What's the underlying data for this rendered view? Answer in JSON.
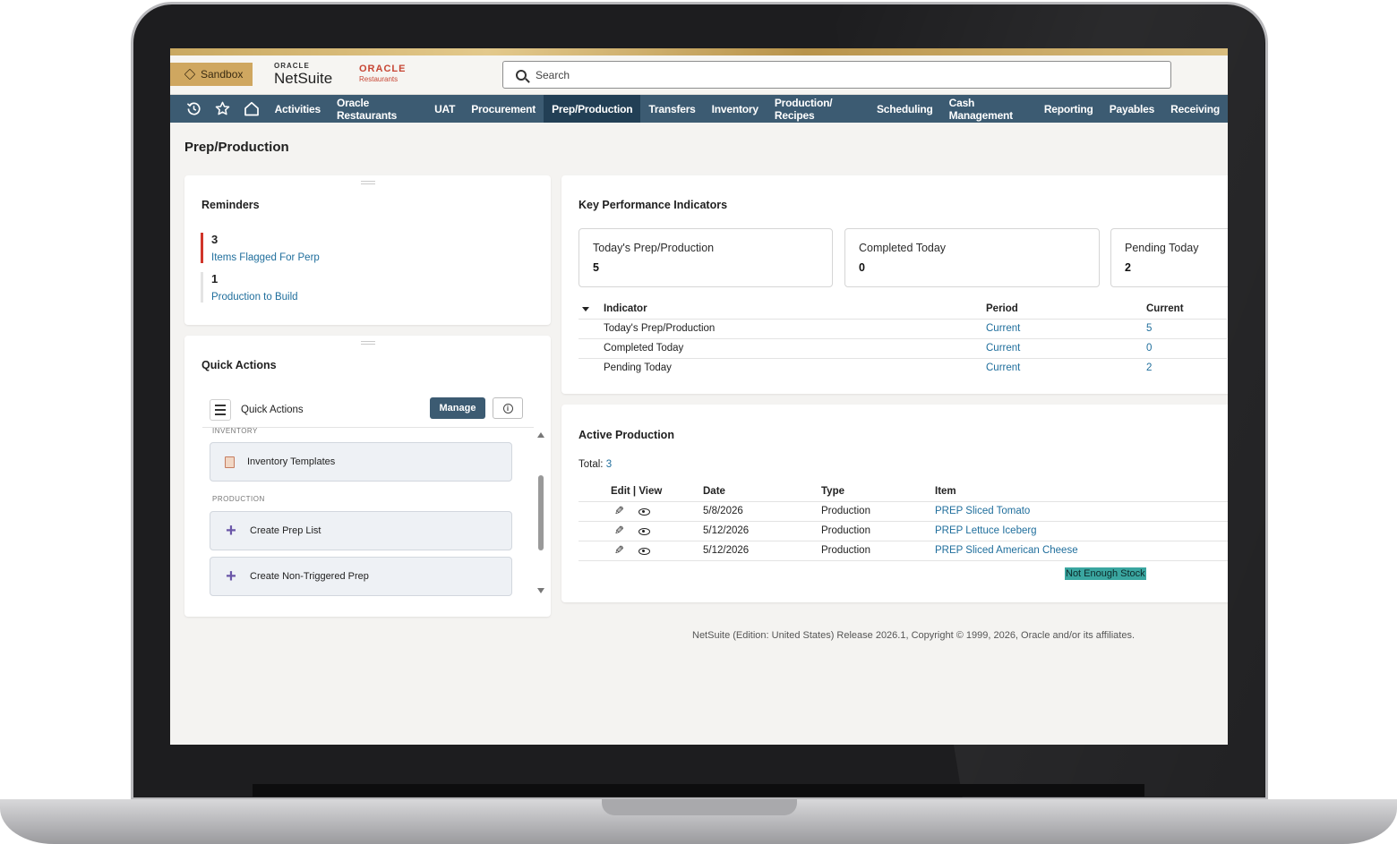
{
  "header": {
    "sandbox_label": "Sandbox",
    "netsuite_oracle": "ORACLE",
    "netsuite_name": "NetSuite",
    "restaurants_oracle": "ORACLE",
    "restaurants_name": "Restaurants",
    "search_placeholder": "Search"
  },
  "nav": {
    "items": [
      {
        "label": "Activities"
      },
      {
        "label": "Oracle Restaurants"
      },
      {
        "label": "UAT"
      },
      {
        "label": "Procurement"
      },
      {
        "label": "Prep/Production",
        "active": true
      },
      {
        "label": "Transfers"
      },
      {
        "label": "Inventory"
      },
      {
        "label": "Production/ Recipes"
      },
      {
        "label": "Scheduling"
      },
      {
        "label": "Cash Management"
      },
      {
        "label": "Reporting"
      },
      {
        "label": "Payables"
      },
      {
        "label": "Receiving"
      }
    ]
  },
  "page": {
    "title": "Prep/Production"
  },
  "reminders": {
    "title": "Reminders",
    "items": [
      {
        "count": "3",
        "label": "Items Flagged For Perp"
      },
      {
        "count": "1",
        "label": "Production to Build"
      }
    ]
  },
  "quick_actions": {
    "title": "Quick Actions",
    "bar_label": "Quick Actions",
    "manage_label": "Manage",
    "sections": [
      {
        "name": "INVENTORY",
        "items": [
          {
            "label": "Inventory Templates",
            "icon": "clipboard-icon"
          }
        ]
      },
      {
        "name": "PRODUCTION",
        "items": [
          {
            "label": "Create Prep List",
            "icon": "plus-icon"
          },
          {
            "label": "Create Non-Triggered Prep",
            "icon": "plus-icon"
          }
        ]
      }
    ]
  },
  "kpi": {
    "title": "Key Performance Indicators",
    "boxes": [
      {
        "label": "Today's Prep/Production",
        "value": "5"
      },
      {
        "label": "Completed Today",
        "value": "0"
      },
      {
        "label": "Pending Today",
        "value": "2"
      }
    ],
    "table": {
      "headers": [
        "Indicator",
        "Period",
        "Current"
      ],
      "rows": [
        {
          "indicator": "Today's Prep/Production",
          "period": "Current",
          "current": "5"
        },
        {
          "indicator": "Completed Today",
          "period": "Current",
          "current": "0"
        },
        {
          "indicator": "Pending Today",
          "period": "Current",
          "current": "2"
        }
      ]
    }
  },
  "active_production": {
    "title": "Active Production",
    "total_label": "Total:",
    "total_value": "3",
    "headers": [
      "Edit | View",
      "Date",
      "Type",
      "Item"
    ],
    "rows": [
      {
        "date": "5/8/2026",
        "type": "Production",
        "item": "PREP Sliced Tomato"
      },
      {
        "date": "5/12/2026",
        "type": "Production",
        "item": "PREP Lettuce Iceberg"
      },
      {
        "date": "5/12/2026",
        "type": "Production",
        "item": "PREP Sliced American Cheese"
      }
    ],
    "status_badge": "Not Enough Stock"
  },
  "footer": {
    "text": "NetSuite (Edition: United States) Release 2026.1, Copyright © 1999, 2026, Oracle and/or its affiliates."
  },
  "colors": {
    "nav_bg": "#3c5b72",
    "nav_active": "#223f55",
    "link": "#1f6e9c",
    "flag": "#d0352a",
    "badge": "#3aa6a0",
    "sandbox": "#cfa760"
  }
}
